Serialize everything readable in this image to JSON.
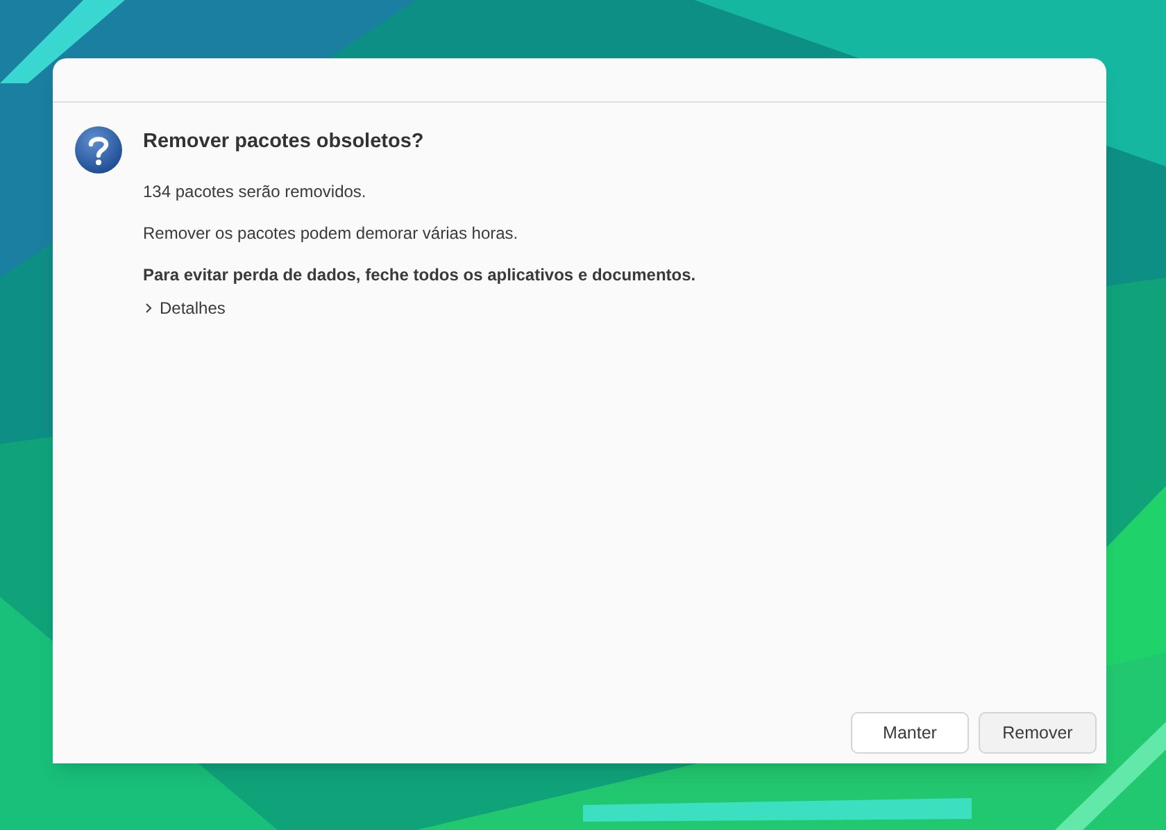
{
  "dialog": {
    "title": "Remover pacotes obsoletos?",
    "messages": [
      {
        "text": "134 pacotes serão removidos.",
        "bold": false
      },
      {
        "text": "Remover os pacotes podem demorar várias horas.",
        "bold": false
      },
      {
        "text": "Para evitar perda de dados, feche todos os aplicativos e documentos.",
        "bold": true
      }
    ],
    "details": {
      "label": "Detalhes",
      "expanded": false
    },
    "buttons": [
      "Manter",
      "Remover"
    ]
  }
}
